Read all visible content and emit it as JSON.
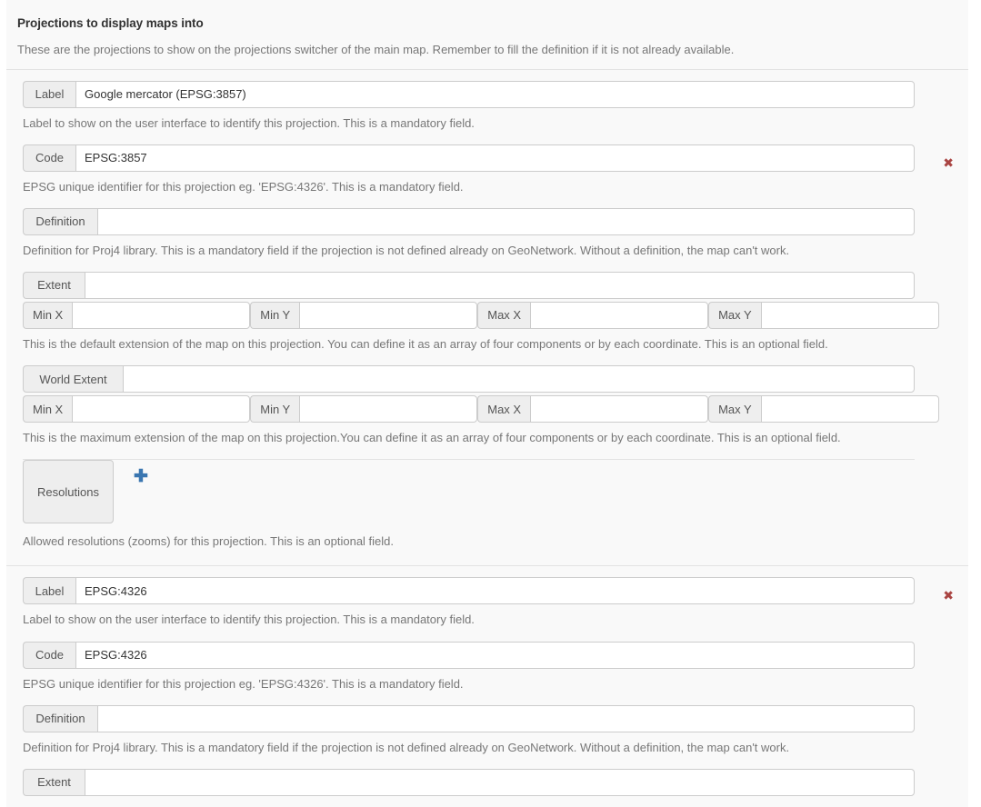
{
  "section": {
    "title": "Projections to display maps into",
    "description": "These are the projections to show on the projections switcher of the main map. Remember to fill the definition if it is not already available."
  },
  "labels": {
    "label": "Label",
    "code": "Code",
    "definition": "Definition",
    "extent": "Extent",
    "world_extent": "World Extent",
    "min_x": "Min X",
    "min_y": "Min Y",
    "max_x": "Max X",
    "max_y": "Max Y",
    "resolutions": "Resolutions"
  },
  "help": {
    "label": "Label to show on the user interface to identify this projection. This is a mandatory field.",
    "code": "EPSG unique identifier for this projection eg. 'EPSG:4326'. This is a mandatory field.",
    "definition": "Definition for Proj4 library. This is a mandatory field if the projection is not defined already on GeoNetwork. Without a definition, the map can't work.",
    "extent": "This is the default extension of the map on this projection. You can define it as an array of four components or by each coordinate. This is an optional field.",
    "world_extent": "This is the maximum extension of the map on this projection.You can define it as an array of four components or by each coordinate. This is an optional field.",
    "resolutions": "Allowed resolutions (zooms) for this projection. This is an optional field."
  },
  "icons": {
    "remove": "✖",
    "add": "✚"
  },
  "colors": {
    "remove_icon": "#a94442",
    "add_icon": "#3a76b0",
    "addon_bg": "#eeeeee",
    "panel_bg": "#f9f9f9",
    "border": "#cccccc"
  },
  "projections": [
    {
      "label_value": "Google mercator (EPSG:3857)",
      "code_value": "EPSG:3857",
      "definition_value": "",
      "extent_value": "",
      "extent_min_x": "",
      "extent_min_y": "",
      "extent_max_x": "",
      "extent_max_y": "",
      "world_extent_value": "",
      "world_min_x": "",
      "world_min_y": "",
      "world_max_x": "",
      "world_max_y": "",
      "resolutions": []
    },
    {
      "label_value": "EPSG:4326",
      "code_value": "EPSG:4326",
      "definition_value": "",
      "extent_value": "",
      "extent_min_x": "",
      "extent_min_y": "",
      "extent_max_x": "",
      "extent_max_y": "",
      "world_extent_value": "",
      "world_min_x": "",
      "world_min_y": "",
      "world_max_x": "",
      "world_max_y": "",
      "resolutions": []
    }
  ]
}
